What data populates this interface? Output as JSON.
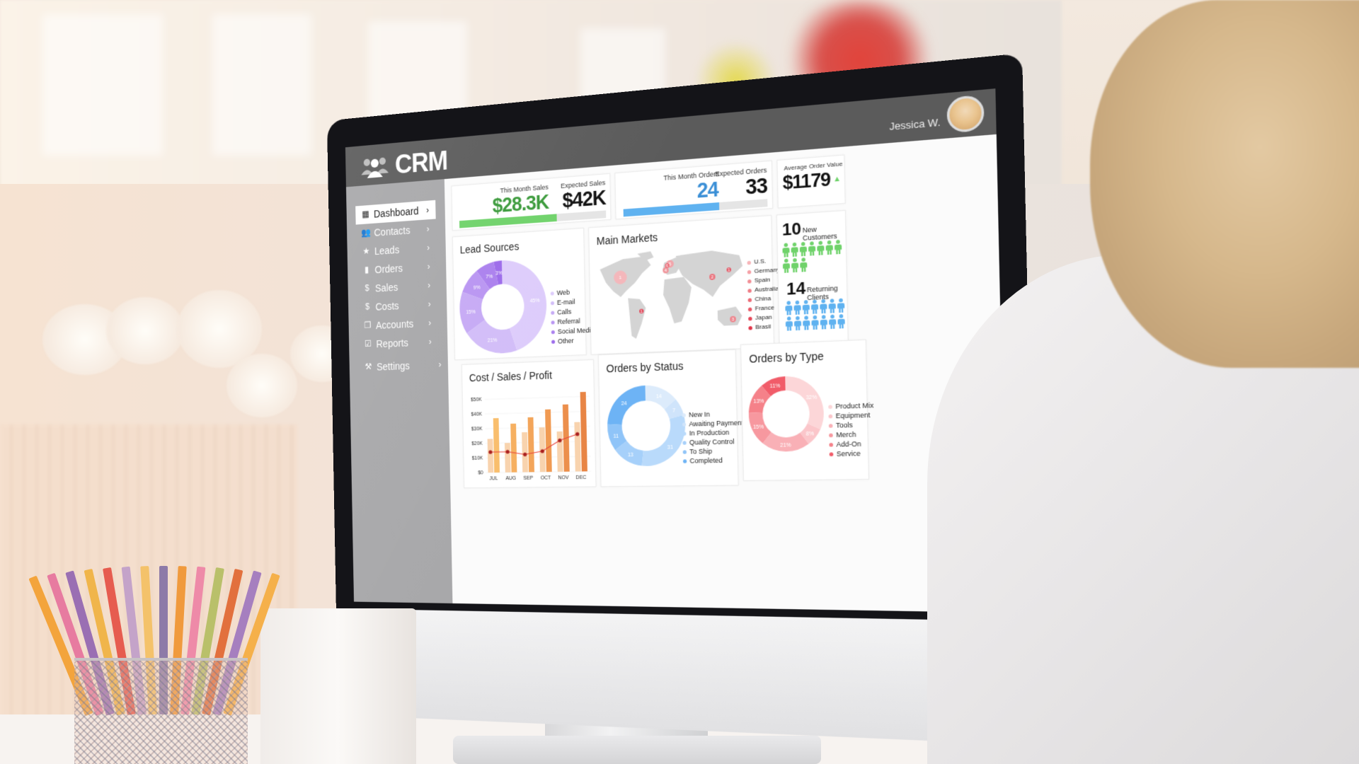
{
  "app": {
    "title": "CRM",
    "logo_icon": "users-icon"
  },
  "user": {
    "name": "Jessica W.",
    "avatar_icon": "user-avatar"
  },
  "sidebar": {
    "items": [
      {
        "label": "Dashboard",
        "icon": "grid-icon",
        "glyph": "▦",
        "active": true
      },
      {
        "label": "Contacts",
        "icon": "contacts-icon",
        "glyph": "👥",
        "active": false
      },
      {
        "label": "Leads",
        "icon": "star-icon",
        "glyph": "★",
        "active": false
      },
      {
        "label": "Orders",
        "icon": "bar-chart-icon",
        "glyph": "▮",
        "active": false
      },
      {
        "label": "Sales",
        "icon": "dollar-circle-filled-icon",
        "glyph": "$",
        "active": false
      },
      {
        "label": "Costs",
        "icon": "dollar-circle-outline-icon",
        "glyph": "$",
        "active": false
      },
      {
        "label": "Accounts",
        "icon": "copy-icon",
        "glyph": "❐",
        "active": false
      },
      {
        "label": "Reports",
        "icon": "checkbox-icon",
        "glyph": "☑",
        "active": false
      }
    ],
    "settings": {
      "label": "Settings",
      "icon": "tools-icon",
      "glyph": "✕"
    },
    "chevron": "›"
  },
  "kpis": {
    "sales": {
      "this_month_label": "This Month Sales",
      "this_month_value": "$28.3K",
      "expected_label": "Expected Sales",
      "expected_value": "$42K",
      "progress": 0.67,
      "color": "#3a9a3a",
      "bar_color": "#6fd26a"
    },
    "orders": {
      "this_month_label": "This Month Orders",
      "this_month_value": "24",
      "expected_label": "Expected Orders",
      "expected_value": "33",
      "progress": 0.67,
      "color": "#3b8fd6",
      "bar_color": "#5fb2f0"
    },
    "average": {
      "label": "Average Order Value",
      "value": "$1179",
      "trend": "up",
      "trend_glyph": "▲",
      "trend_color": "#6fd26a"
    }
  },
  "customers": {
    "new": {
      "count": "10",
      "label": "New Customers",
      "icons": 10,
      "color": "#6fd26a"
    },
    "returning": {
      "count": "14",
      "label": "Returning Clients",
      "icons": 14,
      "color": "#5fb2f0"
    }
  },
  "map": {
    "title": "Main Markets",
    "legend": [
      "U.S.",
      "Germany",
      "Spain",
      "Australia",
      "China",
      "France",
      "Japan",
      "Brasil"
    ],
    "markers": [
      {
        "country": "U.S.",
        "label": "1"
      },
      {
        "country": "Germany",
        "label": "5"
      },
      {
        "country": "Spain",
        "label": "4"
      },
      {
        "country": "France",
        "label": "6"
      },
      {
        "country": "China",
        "label": "2"
      },
      {
        "country": "Japan",
        "label": "1"
      },
      {
        "country": "Australia",
        "label": "3"
      },
      {
        "country": "Brasil",
        "label": "1"
      }
    ]
  },
  "chart_data": [
    {
      "type": "pie",
      "title": "Lead Sources",
      "donut": true,
      "categories": [
        "Web",
        "E-mail",
        "Calls",
        "Referral",
        "Social Media",
        "Other"
      ],
      "values": [
        45,
        21,
        15,
        9,
        7,
        3
      ],
      "labels": [
        "45%",
        "21%",
        "15%",
        "9%",
        "7%",
        "3%"
      ],
      "colors": [
        "#ddccfb",
        "#d2bdf8",
        "#c6aaf5",
        "#b995f2",
        "#ab80ee",
        "#9c6aea"
      ],
      "legend": "right"
    },
    {
      "type": "bar",
      "title": "Cost / Sales / Profit",
      "categories": [
        "JUL",
        "AUG",
        "SEP",
        "OCT",
        "NOV",
        "DEC"
      ],
      "series": [
        {
          "name": "Cost",
          "kind": "bar",
          "values": [
            23000,
            20000,
            27000,
            30000,
            27000,
            33000
          ],
          "color": "#f8d3ae"
        },
        {
          "name": "Sales",
          "kind": "bar",
          "values": [
            37000,
            33000,
            37000,
            42000,
            45000,
            53000
          ],
          "colors": [
            "#f9be6c",
            "#f6b061",
            "#f3a55a",
            "#f09a52",
            "#ec8f4c",
            "#e88545"
          ]
        },
        {
          "name": "Profit",
          "kind": "line",
          "values": [
            14000,
            14000,
            12000,
            14000,
            21000,
            25000
          ],
          "color": "#e8443c",
          "marker_color": "#a9201f"
        }
      ],
      "yticks": [
        "$0",
        "$10K",
        "$20K",
        "$30K",
        "$40K",
        "$50K"
      ],
      "ylim": [
        0,
        55000
      ],
      "xlabel": "",
      "ylabel": "",
      "grid": true
    },
    {
      "type": "pie",
      "title": "Orders by Status",
      "donut": true,
      "categories": [
        "New In",
        "Awaiting Payment",
        "In Production",
        "Quality Control",
        "To Ship",
        "Completed"
      ],
      "values": [
        14,
        7,
        31,
        13,
        11,
        24
      ],
      "labels": [
        "14",
        "7",
        "31",
        "13",
        "11",
        "24"
      ],
      "colors": [
        "#dcebfb",
        "#cfe4fb",
        "#b9dafb",
        "#a6d0fa",
        "#8fc4f8",
        "#6db3f5"
      ],
      "legend": "right"
    },
    {
      "type": "pie",
      "title": "Orders by Type",
      "donut": true,
      "categories": [
        "Product Mix",
        "Equipment",
        "Tools",
        "Merch",
        "Add-On",
        "Service"
      ],
      "values": [
        32,
        8,
        21,
        15,
        13,
        11
      ],
      "labels": [
        "32%",
        "8%",
        "21%",
        "15%",
        "13%",
        "11%"
      ],
      "colors": [
        "#fcd6d8",
        "#fbc6ca",
        "#f9b0b6",
        "#f7989f",
        "#f58189",
        "#f15c69"
      ],
      "legend": "right"
    }
  ]
}
